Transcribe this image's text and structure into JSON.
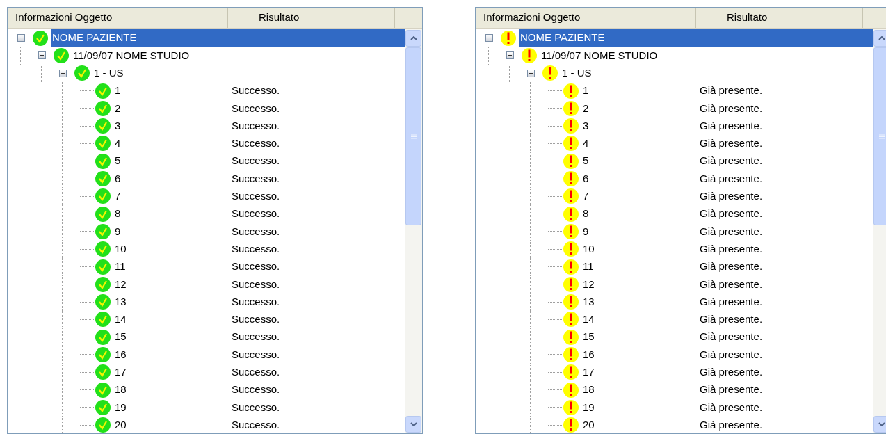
{
  "panels": [
    {
      "kind": "success",
      "columns": [
        "Informazioni Oggetto",
        "Risultato"
      ],
      "tree": [
        {
          "label": "NOME PAZIENTE",
          "selected": true,
          "expanded": true,
          "children": [
            {
              "label": "11/09/07 NOME STUDIO",
              "selected": false,
              "expanded": true,
              "children": [
                {
                  "label": "1 - US",
                  "selected": false,
                  "expanded": true,
                  "children": [
                    {
                      "label": "1",
                      "result": "Successo.",
                      "selected": false
                    },
                    {
                      "label": "2",
                      "result": "Successo.",
                      "selected": false
                    },
                    {
                      "label": "3",
                      "result": "Successo.",
                      "selected": false
                    },
                    {
                      "label": "4",
                      "result": "Successo.",
                      "selected": false
                    },
                    {
                      "label": "5",
                      "result": "Successo.",
                      "selected": false
                    },
                    {
                      "label": "6",
                      "result": "Successo.",
                      "selected": false
                    },
                    {
                      "label": "7",
                      "result": "Successo.",
                      "selected": false
                    },
                    {
                      "label": "8",
                      "result": "Successo.",
                      "selected": false
                    },
                    {
                      "label": "9",
                      "result": "Successo.",
                      "selected": false
                    },
                    {
                      "label": "10",
                      "result": "Successo.",
                      "selected": false
                    },
                    {
                      "label": "11",
                      "result": "Successo.",
                      "selected": false
                    },
                    {
                      "label": "12",
                      "result": "Successo.",
                      "selected": false
                    },
                    {
                      "label": "13",
                      "result": "Successo.",
                      "selected": false
                    },
                    {
                      "label": "14",
                      "result": "Successo.",
                      "selected": false
                    },
                    {
                      "label": "15",
                      "result": "Successo.",
                      "selected": false
                    },
                    {
                      "label": "16",
                      "result": "Successo.",
                      "selected": false
                    },
                    {
                      "label": "17",
                      "result": "Successo.",
                      "selected": false
                    },
                    {
                      "label": "18",
                      "result": "Successo.",
                      "selected": false
                    },
                    {
                      "label": "19",
                      "result": "Successo.",
                      "selected": false
                    },
                    {
                      "label": "20",
                      "result": "Successo.",
                      "selected": false
                    }
                  ]
                }
              ]
            }
          ]
        }
      ]
    },
    {
      "kind": "warning",
      "columns": [
        "Informazioni Oggetto",
        "Risultato"
      ],
      "tree": [
        {
          "label": "NOME PAZIENTE",
          "selected": true,
          "expanded": true,
          "children": [
            {
              "label": "11/09/07 NOME STUDIO",
              "selected": false,
              "expanded": true,
              "children": [
                {
                  "label": "1 - US",
                  "selected": false,
                  "expanded": true,
                  "children": [
                    {
                      "label": "1",
                      "result": "Già presente.",
                      "selected": false
                    },
                    {
                      "label": "2",
                      "result": "Già presente.",
                      "selected": false
                    },
                    {
                      "label": "3",
                      "result": "Già presente.",
                      "selected": false
                    },
                    {
                      "label": "4",
                      "result": "Già presente.",
                      "selected": false
                    },
                    {
                      "label": "5",
                      "result": "Già presente.",
                      "selected": false
                    },
                    {
                      "label": "6",
                      "result": "Già presente.",
                      "selected": false
                    },
                    {
                      "label": "7",
                      "result": "Già presente.",
                      "selected": false
                    },
                    {
                      "label": "8",
                      "result": "Già presente.",
                      "selected": false
                    },
                    {
                      "label": "9",
                      "result": "Già presente.",
                      "selected": false
                    },
                    {
                      "label": "10",
                      "result": "Già presente.",
                      "selected": false
                    },
                    {
                      "label": "11",
                      "result": "Già presente.",
                      "selected": false
                    },
                    {
                      "label": "12",
                      "result": "Già presente.",
                      "selected": false
                    },
                    {
                      "label": "13",
                      "result": "Già presente.",
                      "selected": false
                    },
                    {
                      "label": "14",
                      "result": "Già presente.",
                      "selected": false
                    },
                    {
                      "label": "15",
                      "result": "Già presente.",
                      "selected": false
                    },
                    {
                      "label": "16",
                      "result": "Già presente.",
                      "selected": false
                    },
                    {
                      "label": "17",
                      "result": "Già presente.",
                      "selected": false
                    },
                    {
                      "label": "18",
                      "result": "Già presente.",
                      "selected": false
                    },
                    {
                      "label": "19",
                      "result": "Già presente.",
                      "selected": false
                    },
                    {
                      "label": "20",
                      "result": "Già presente.",
                      "selected": false
                    }
                  ]
                }
              ]
            }
          ]
        }
      ]
    }
  ]
}
